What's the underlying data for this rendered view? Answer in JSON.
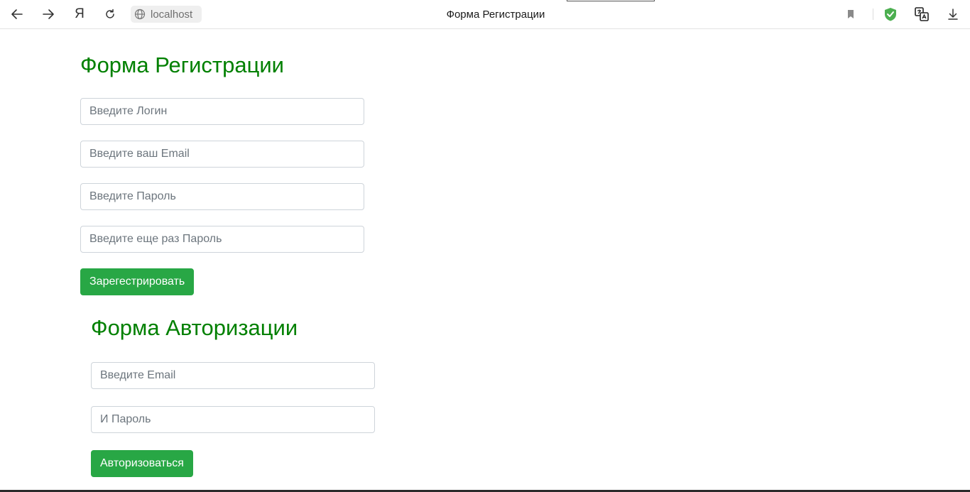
{
  "browser": {
    "tab_title": "Форма Регистрации",
    "address": "localhost",
    "yandex_glyph": "Я",
    "icons": {
      "back": "arrow-left-icon",
      "forward": "arrow-right-icon",
      "yandex": "yandex-logo-icon",
      "reload": "reload-icon",
      "site_info": "globe-icon",
      "bookmark": "bookmark-icon",
      "protect": "shield-check-icon",
      "translate": "translate-icon",
      "downloads": "download-icon"
    },
    "colors": {
      "protect": "#4caf50"
    }
  },
  "register": {
    "title": "Форма Регистрации",
    "login_placeholder": "Введите Логин",
    "email_placeholder": "Введите ваш Email",
    "password_placeholder": "Введите Пароль",
    "password_repeat_placeholder": "Введите еще раз Пароль",
    "submit_label": "Зарегестрировать"
  },
  "auth": {
    "title": "Форма Авторизации",
    "email_placeholder": "Введите Email",
    "password_placeholder": "И Пароль",
    "submit_label": "Авторизоваться"
  },
  "colors": {
    "title_green": "#008000",
    "button_green": "#28a745"
  }
}
